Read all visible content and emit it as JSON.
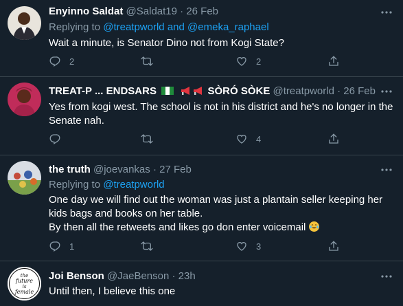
{
  "tweets": [
    {
      "name": "Enyinno Saldat",
      "handle": "@Saldat19",
      "dot": "·",
      "time": "26 Feb",
      "replying_prefix": "Replying to",
      "replying_to": [
        "@treatpworld",
        "@emeka_raphael"
      ],
      "replying_joiner": "and",
      "text": "Wait a minute, is Senator Dino not from Kogi State?",
      "replies": "2",
      "retweets": "",
      "likes": "2"
    },
    {
      "name": "TREAT-P ... ENDSARS",
      "name_suffix": "SÒRÓ SÒKE",
      "handle": "@treatpworld",
      "dot": "·",
      "time": "26 Feb",
      "text_lines": [
        "Yes from kogi west. The school is not in his district and he's no longer in the",
        "Senate nah."
      ],
      "replies": "",
      "retweets": "",
      "likes": "4"
    },
    {
      "name": "the truth",
      "handle": "@joevankas",
      "dot": "·",
      "time": "27 Feb",
      "replying_prefix": "Replying to",
      "replying_to": [
        "@treatpworld"
      ],
      "text_lines": [
        "One day we will find out the woman was just a plantain seller keeping her",
        "kids bags and books on her table.",
        "By then all the retweets and likes go don enter voicemail"
      ],
      "replies": "1",
      "retweets": "",
      "likes": "3"
    },
    {
      "name": "Joi Benson",
      "handle": "@JaeBenson",
      "dot": "·",
      "time": "23h",
      "text": "Until then, I believe this one",
      "avatar_text": [
        "the",
        "future",
        "is",
        "female"
      ]
    }
  ],
  "colors": {
    "background": "#15202b",
    "secondary_text": "#8899a6",
    "link": "#1da1f2",
    "divider": "#38444d"
  },
  "icons": [
    "reply-icon",
    "retweet-icon",
    "like-icon",
    "share-icon",
    "more-icon"
  ]
}
